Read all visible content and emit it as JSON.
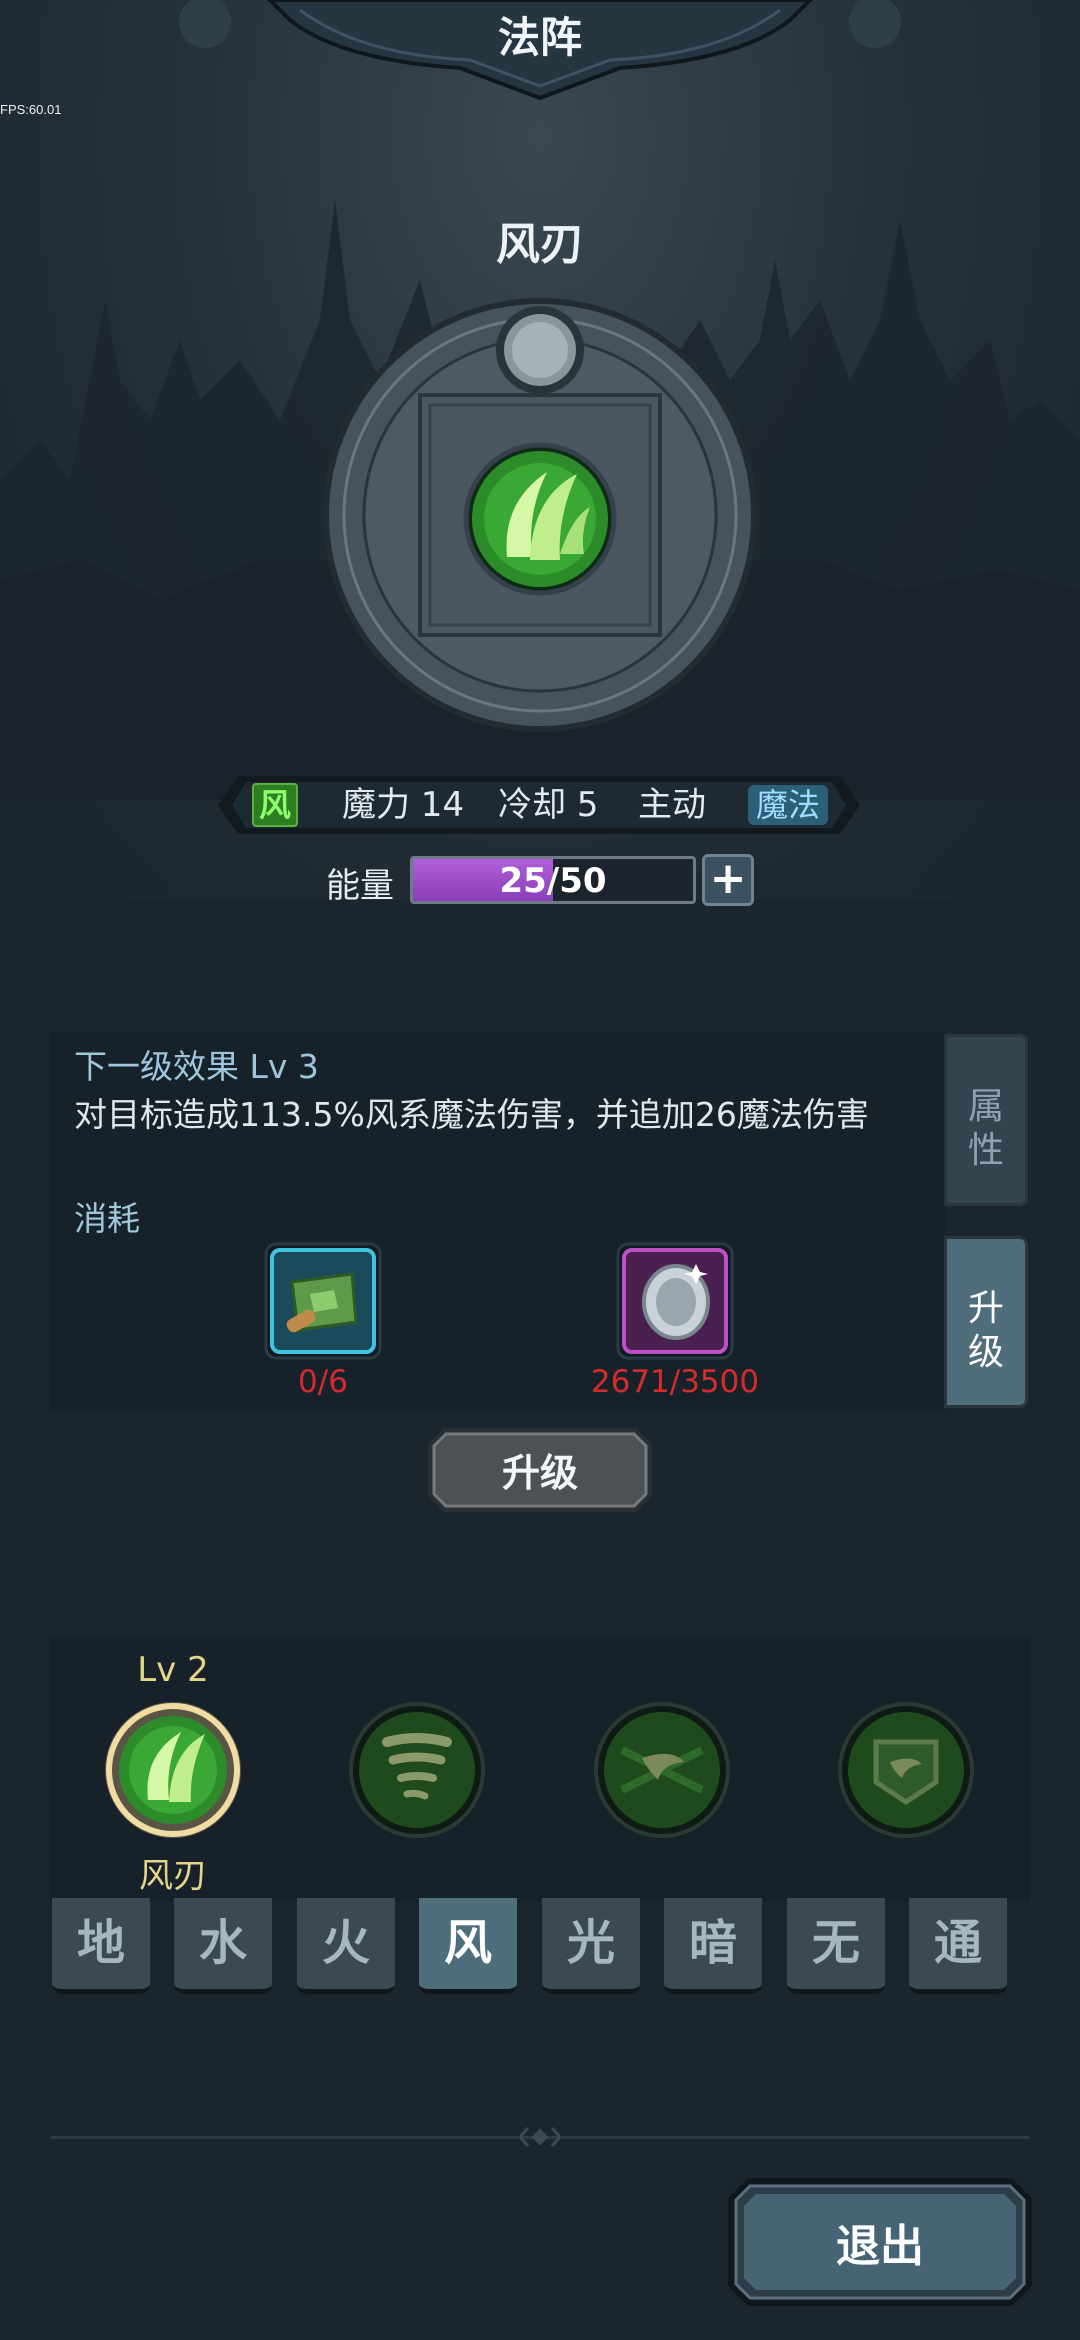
{
  "debug": {
    "fps": "FPS:60.01"
  },
  "header": {
    "title": "法阵"
  },
  "skill": {
    "name": "风刃",
    "icon": "wind-blade-icon"
  },
  "info": {
    "element_tag": "风",
    "mana": "魔力 14",
    "cooldown": "冷却 5",
    "mode": "主动",
    "type_tag": "魔法"
  },
  "energy": {
    "label": "能量",
    "current": 25,
    "max": 50,
    "text": "25/50",
    "plus": "+"
  },
  "effect_panel": {
    "title": "下一级效果 Lv 3",
    "description": "对目标造成113.5%风系魔法伤害，并追加26魔法伤害",
    "cost_label": "消耗",
    "costs": [
      {
        "icon": "scroll-map-icon",
        "count": "0/6"
      },
      {
        "icon": "silver-coin-icon",
        "count": "2671/3500"
      }
    ]
  },
  "side_tabs": {
    "attributes": "属性",
    "upgrade": "升级"
  },
  "upgrade_button": "升级",
  "skills": {
    "selected_level": "Lv 2",
    "selected_name": "风刃",
    "items": [
      "wind-blade-icon",
      "tornado-icon",
      "whirlwind-icon",
      "wind-shield-icon"
    ]
  },
  "element_tabs": [
    "地",
    "水",
    "火",
    "风",
    "光",
    "暗",
    "无",
    "通"
  ],
  "active_element": "风",
  "exit_button": "退出",
  "colors": {
    "accent": "#4e6e7b",
    "energy": "#9b4fcf",
    "cost_red": "#d42c2c",
    "level_gold": "#e6d48a"
  }
}
